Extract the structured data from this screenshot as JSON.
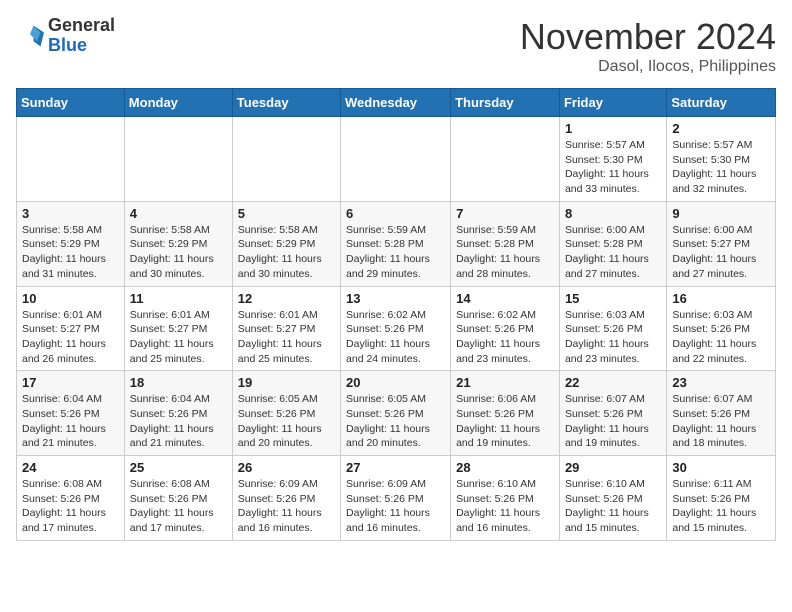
{
  "header": {
    "logo_general": "General",
    "logo_blue": "Blue",
    "month": "November 2024",
    "location": "Dasol, Ilocos, Philippines"
  },
  "weekdays": [
    "Sunday",
    "Monday",
    "Tuesday",
    "Wednesday",
    "Thursday",
    "Friday",
    "Saturday"
  ],
  "weeks": [
    [
      {
        "day": "",
        "info": ""
      },
      {
        "day": "",
        "info": ""
      },
      {
        "day": "",
        "info": ""
      },
      {
        "day": "",
        "info": ""
      },
      {
        "day": "",
        "info": ""
      },
      {
        "day": "1",
        "info": "Sunrise: 5:57 AM\nSunset: 5:30 PM\nDaylight: 11 hours and 33 minutes."
      },
      {
        "day": "2",
        "info": "Sunrise: 5:57 AM\nSunset: 5:30 PM\nDaylight: 11 hours and 32 minutes."
      }
    ],
    [
      {
        "day": "3",
        "info": "Sunrise: 5:58 AM\nSunset: 5:29 PM\nDaylight: 11 hours and 31 minutes."
      },
      {
        "day": "4",
        "info": "Sunrise: 5:58 AM\nSunset: 5:29 PM\nDaylight: 11 hours and 30 minutes."
      },
      {
        "day": "5",
        "info": "Sunrise: 5:58 AM\nSunset: 5:29 PM\nDaylight: 11 hours and 30 minutes."
      },
      {
        "day": "6",
        "info": "Sunrise: 5:59 AM\nSunset: 5:28 PM\nDaylight: 11 hours and 29 minutes."
      },
      {
        "day": "7",
        "info": "Sunrise: 5:59 AM\nSunset: 5:28 PM\nDaylight: 11 hours and 28 minutes."
      },
      {
        "day": "8",
        "info": "Sunrise: 6:00 AM\nSunset: 5:28 PM\nDaylight: 11 hours and 27 minutes."
      },
      {
        "day": "9",
        "info": "Sunrise: 6:00 AM\nSunset: 5:27 PM\nDaylight: 11 hours and 27 minutes."
      }
    ],
    [
      {
        "day": "10",
        "info": "Sunrise: 6:01 AM\nSunset: 5:27 PM\nDaylight: 11 hours and 26 minutes."
      },
      {
        "day": "11",
        "info": "Sunrise: 6:01 AM\nSunset: 5:27 PM\nDaylight: 11 hours and 25 minutes."
      },
      {
        "day": "12",
        "info": "Sunrise: 6:01 AM\nSunset: 5:27 PM\nDaylight: 11 hours and 25 minutes."
      },
      {
        "day": "13",
        "info": "Sunrise: 6:02 AM\nSunset: 5:26 PM\nDaylight: 11 hours and 24 minutes."
      },
      {
        "day": "14",
        "info": "Sunrise: 6:02 AM\nSunset: 5:26 PM\nDaylight: 11 hours and 23 minutes."
      },
      {
        "day": "15",
        "info": "Sunrise: 6:03 AM\nSunset: 5:26 PM\nDaylight: 11 hours and 23 minutes."
      },
      {
        "day": "16",
        "info": "Sunrise: 6:03 AM\nSunset: 5:26 PM\nDaylight: 11 hours and 22 minutes."
      }
    ],
    [
      {
        "day": "17",
        "info": "Sunrise: 6:04 AM\nSunset: 5:26 PM\nDaylight: 11 hours and 21 minutes."
      },
      {
        "day": "18",
        "info": "Sunrise: 6:04 AM\nSunset: 5:26 PM\nDaylight: 11 hours and 21 minutes."
      },
      {
        "day": "19",
        "info": "Sunrise: 6:05 AM\nSunset: 5:26 PM\nDaylight: 11 hours and 20 minutes."
      },
      {
        "day": "20",
        "info": "Sunrise: 6:05 AM\nSunset: 5:26 PM\nDaylight: 11 hours and 20 minutes."
      },
      {
        "day": "21",
        "info": "Sunrise: 6:06 AM\nSunset: 5:26 PM\nDaylight: 11 hours and 19 minutes."
      },
      {
        "day": "22",
        "info": "Sunrise: 6:07 AM\nSunset: 5:26 PM\nDaylight: 11 hours and 19 minutes."
      },
      {
        "day": "23",
        "info": "Sunrise: 6:07 AM\nSunset: 5:26 PM\nDaylight: 11 hours and 18 minutes."
      }
    ],
    [
      {
        "day": "24",
        "info": "Sunrise: 6:08 AM\nSunset: 5:26 PM\nDaylight: 11 hours and 17 minutes."
      },
      {
        "day": "25",
        "info": "Sunrise: 6:08 AM\nSunset: 5:26 PM\nDaylight: 11 hours and 17 minutes."
      },
      {
        "day": "26",
        "info": "Sunrise: 6:09 AM\nSunset: 5:26 PM\nDaylight: 11 hours and 16 minutes."
      },
      {
        "day": "27",
        "info": "Sunrise: 6:09 AM\nSunset: 5:26 PM\nDaylight: 11 hours and 16 minutes."
      },
      {
        "day": "28",
        "info": "Sunrise: 6:10 AM\nSunset: 5:26 PM\nDaylight: 11 hours and 16 minutes."
      },
      {
        "day": "29",
        "info": "Sunrise: 6:10 AM\nSunset: 5:26 PM\nDaylight: 11 hours and 15 minutes."
      },
      {
        "day": "30",
        "info": "Sunrise: 6:11 AM\nSunset: 5:26 PM\nDaylight: 11 hours and 15 minutes."
      }
    ]
  ]
}
